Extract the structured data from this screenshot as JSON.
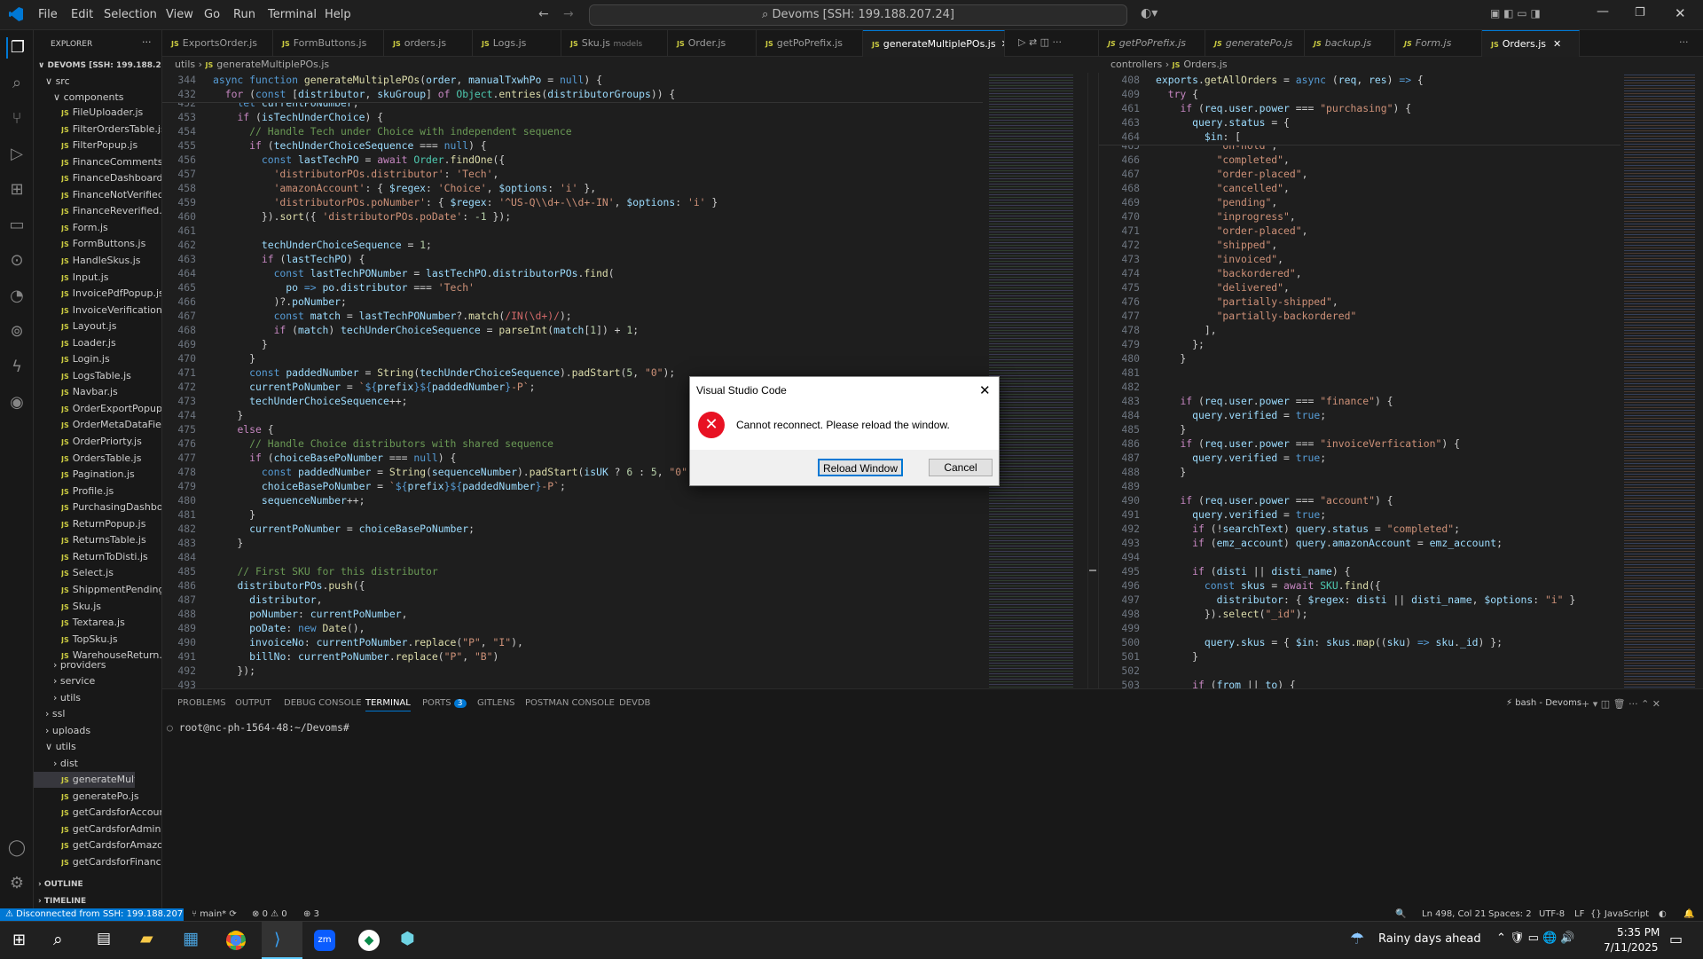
{
  "menu": {
    "items": [
      "File",
      "Edit",
      "Selection",
      "View",
      "Go",
      "Run",
      "Terminal",
      "Help"
    ],
    "search": "Devoms [SSH: 199.188.207.24]"
  },
  "explorer": {
    "title": "EXPLORER",
    "root": "DEVOMS [SSH: 199.188.20...",
    "folders": {
      "src": "src",
      "components": "components",
      "providers": "providers",
      "service": "service",
      "utils": "utils",
      "ssl": "ssl",
      "uploads": "uploads",
      "utils2": "utils",
      "dist": "dist"
    },
    "components": [
      "FileUploader.js",
      "FilterOrdersTable.js",
      "FilterPopup.js",
      "FinanceComments.js",
      "FinanceDashboard.js",
      "FinanceNotVerified...",
      "FinanceReverified...",
      "Form.js",
      "FormButtons.js",
      "HandleSkus.js",
      "Input.js",
      "InvoicePdfPopup.js",
      "InvoiceVerification...",
      "Layout.js",
      "Loader.js",
      "Login.js",
      "LogsTable.js",
      "Navbar.js",
      "OrderExportPopup.js",
      "OrderMetaDataFiel...",
      "OrderPriorty.js",
      "OrdersTable.js",
      "Pagination.js",
      "Profile.js",
      "PurchasingDashbo...",
      "ReturnPopup.js",
      "ReturnsTable.js",
      "ReturnToDisti.js",
      "Select.js",
      "ShippmentPending...",
      "Sku.js",
      "Textarea.js",
      "TopSku.js",
      "WarehouseReturn.js"
    ],
    "utils_files": [
      "generateMultiplePO...",
      "generatePo.js",
      "getCardsforAccount.js",
      "getCardsforAdmin.js",
      "getCardsforAmazon.js",
      "getCardsforFinance.js"
    ],
    "outline": "OUTLINE",
    "timeline": "TIMELINE"
  },
  "tabs_left": [
    "ExportsOrder.js",
    "FormButtons.js",
    "orders.js",
    "Logs.js",
    "Sku.js",
    "Order.js",
    "getPoPrefix.js",
    "generateMultiplePOs.js"
  ],
  "tabs_left_sku_hint": "models",
  "tabs_right": [
    "getPoPrefix.js",
    "generatePo.js",
    "backup.js",
    "Form.js",
    "Orders.js"
  ],
  "breadcrumb_left": {
    "folder": "utils",
    "file": "generateMultiplePOs.js"
  },
  "breadcrumb_right": {
    "folder": "controllers",
    "file": "Orders.js"
  },
  "left_sticky": [
    {
      "ln": "344",
      "text": "async function generateMultiplePOs(order, manualTxwhPo = null) {"
    },
    {
      "ln": "432",
      "text": "  for (const [distributor, skuGroup] of Object.entries(distributorGroups)) {"
    }
  ],
  "left_lines": [
    "452",
    "453",
    "454",
    "455",
    "456",
    "457",
    "458",
    "459",
    "460",
    "461",
    "462",
    "463",
    "464",
    "465",
    "466",
    "467",
    "468",
    "469",
    "470",
    "471",
    "472",
    "473",
    "474",
    "475",
    "476",
    "477",
    "478",
    "479",
    "480",
    "481",
    "482",
    "483",
    "484",
    "485",
    "486",
    "487",
    "488",
    "489",
    "490",
    "491",
    "492",
    "493"
  ],
  "right_sticky": [
    {
      "ln": "408",
      "text": "exports.getAllOrders = async (req, res) => {"
    },
    {
      "ln": "409",
      "text": "  try {"
    },
    {
      "ln": "461",
      "text": "    if (req.user.power === \"purchasing\") {"
    },
    {
      "ln": "463",
      "text": "      query.status = {"
    },
    {
      "ln": "464",
      "text": "        $in: ["
    }
  ],
  "right_lines": [
    "465",
    "466",
    "467",
    "468",
    "469",
    "470",
    "471",
    "472",
    "473",
    "474",
    "475",
    "476",
    "477",
    "478",
    "479",
    "480",
    "481",
    "482",
    "483",
    "484",
    "485",
    "486",
    "487",
    "488",
    "489",
    "490",
    "491",
    "492",
    "493",
    "494",
    "495",
    "496",
    "497",
    "498",
    "499",
    "500",
    "501",
    "502",
    "503"
  ],
  "panel": {
    "tabs": [
      "PROBLEMS",
      "OUTPUT",
      "DEBUG CONSOLE",
      "TERMINAL",
      "PORTS",
      "GITLENS",
      "POSTMAN CONSOLE",
      "DEVDB"
    ],
    "ports_badge": "3",
    "prompt": "root@nc-ph-1564-48:~/Devoms#",
    "shell": "bash - Devoms"
  },
  "status": {
    "remote": "Disconnected from SSH: 199.188.207.24",
    "branch": "main*",
    "errors": "0",
    "warnings": "0",
    "ports": "3",
    "position": "Ln 498, Col 21",
    "spaces": "Spaces: 2",
    "encoding": "UTF-8",
    "eol": "LF",
    "language": "JavaScript"
  },
  "dialog": {
    "title": "Visual Studio Code",
    "message": "Cannot reconnect. Please reload the window.",
    "primary": "Reload Window",
    "secondary": "Cancel"
  },
  "taskbar": {
    "weather": "Rainy days ahead",
    "time": "5:35 PM",
    "date": "7/11/2025"
  }
}
